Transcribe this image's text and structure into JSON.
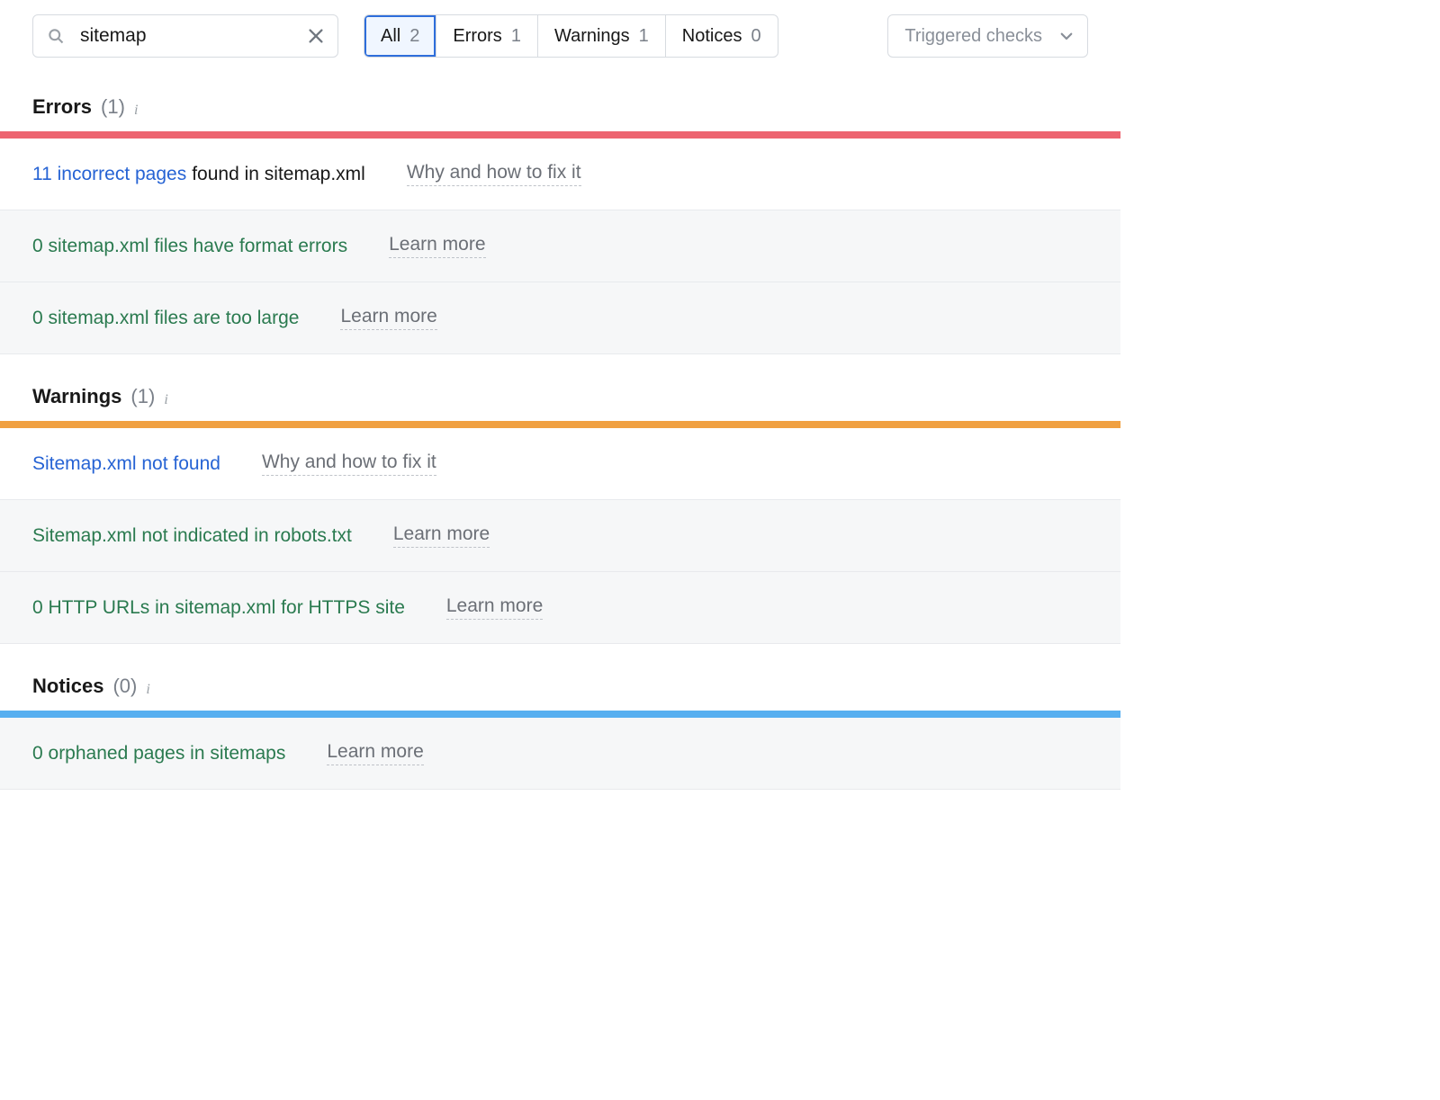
{
  "search": {
    "value": "sitemap"
  },
  "filters": {
    "all": {
      "label": "All",
      "count": "2"
    },
    "errors": {
      "label": "Errors",
      "count": "1"
    },
    "warnings": {
      "label": "Warnings",
      "count": "1"
    },
    "notices": {
      "label": "Notices",
      "count": "0"
    }
  },
  "triggered": {
    "label": "Triggered checks"
  },
  "sections": {
    "errors": {
      "title": "Errors",
      "count": "(1)",
      "items": [
        {
          "type": "active",
          "link": "11 incorrect pages",
          "text": " found in sitemap.xml",
          "help": "Why and how to fix it"
        },
        {
          "type": "inactive",
          "text": "0 sitemap.xml files have format errors",
          "help": "Learn more"
        },
        {
          "type": "inactive",
          "text": "0 sitemap.xml files are too large",
          "help": "Learn more"
        }
      ]
    },
    "warnings": {
      "title": "Warnings",
      "count": "(1)",
      "items": [
        {
          "type": "activefull",
          "link": "Sitemap.xml not found",
          "help": "Why and how to fix it"
        },
        {
          "type": "inactive",
          "text": "Sitemap.xml not indicated in robots.txt",
          "help": "Learn more"
        },
        {
          "type": "inactive",
          "text": "0 HTTP URLs in sitemap.xml for HTTPS site",
          "help": "Learn more"
        }
      ]
    },
    "notices": {
      "title": "Notices",
      "count": "(0)",
      "items": [
        {
          "type": "inactive",
          "text": "0 orphaned pages in sitemaps",
          "help": "Learn more"
        }
      ]
    }
  }
}
